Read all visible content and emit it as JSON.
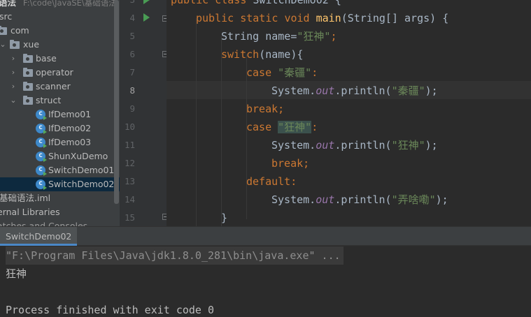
{
  "project": {
    "header_name": "语法",
    "header_path": "F:\\code\\JavaSE\\基础语法",
    "items": [
      {
        "label": "src"
      },
      {
        "label": "com"
      },
      {
        "label": "xue"
      },
      {
        "label": "base"
      },
      {
        "label": "operator"
      },
      {
        "label": "scanner"
      },
      {
        "label": "struct"
      },
      {
        "label": "IfDemo01"
      },
      {
        "label": "IfDemo02"
      },
      {
        "label": "IfDemo03"
      },
      {
        "label": "ShunXuDemo"
      },
      {
        "label": "SwitchDemo01"
      },
      {
        "label": "SwitchDemo02"
      },
      {
        "label": "基础语法.iml"
      },
      {
        "label": "ernal Libraries"
      },
      {
        "label": "atches and Consoles"
      }
    ]
  },
  "editor": {
    "line_numbers": [
      "3",
      "4",
      "5",
      "6",
      "7",
      "8",
      "9",
      "10",
      "11",
      "12",
      "13",
      "14",
      "15"
    ],
    "lines": {
      "l3_kw1": "public",
      "l3_kw2": "class",
      "l3_name": "SwitchDemo02",
      "l3_brace": "{",
      "l4_kw1": "public",
      "l4_kw2": "static",
      "l4_kw3": "void",
      "l4_fn": "main",
      "l4_rest": "(String[] args) {",
      "l5_type": "String name=",
      "l5_str": "\"狂神\"",
      "l5_semi": ";",
      "l6_kw": "switch",
      "l6_rest": "(name){",
      "l7_kw": "case",
      "l7_str": "\"秦疆\"",
      "l7_colon": ":",
      "l8_pre": "System.",
      "l8_fld": "out",
      "l8_mid": ".println(",
      "l8_str": "\"秦疆\"",
      "l8_end": ");",
      "l9_kw": "break",
      "l9_semi": ";",
      "l10_kw": "case",
      "l10_str": "\"狂神\"",
      "l10_colon": ":",
      "l11_pre": "System.",
      "l11_fld": "out",
      "l11_mid": ".println(",
      "l11_str": "\"狂神\"",
      "l11_end": ");",
      "l12_kw": "break",
      "l12_semi": ";",
      "l13_kw": "default",
      "l13_colon": ":",
      "l14_pre": "System.",
      "l14_fld": "out",
      "l14_mid": ".println(",
      "l14_str": "\"弄啥嘞\"",
      "l14_end": ");",
      "l15_brace": "}"
    }
  },
  "run": {
    "tab_label": "SwitchDemo02",
    "command": "\"F:\\Program Files\\Java\\jdk1.8.0_281\\bin\\java.exe\" ...",
    "output": "狂神",
    "exit_message": "Process finished with exit code 0"
  },
  "colors": {
    "keyword": "#cc7832",
    "string": "#6a8759",
    "method": "#ffc66d",
    "field": "#9876aa",
    "selection": "#0d293e",
    "tab_underline": "#4a88c7"
  }
}
